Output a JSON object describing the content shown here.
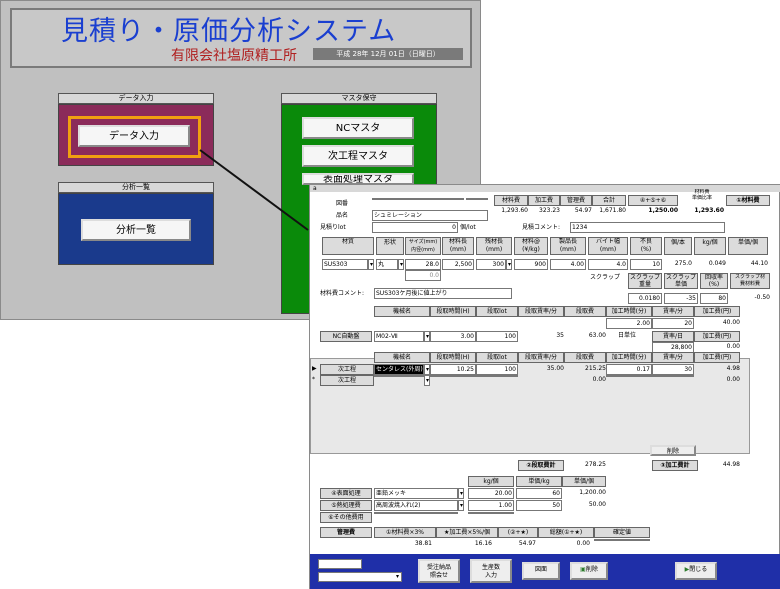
{
  "menu": {
    "title": "見積り・原価分析システム",
    "company": "有限会社塩原精工所",
    "date": "平成 28年 12月 01日（日曜日）",
    "data_entry": {
      "header": "データ入力",
      "button": "データ入力"
    },
    "analysis": {
      "header": "分析一覧",
      "button": "分析一覧"
    },
    "master": {
      "header": "マスタ保守",
      "buttons": [
        "NCマスタ",
        "次工程マスタ",
        "表面処理マスタ"
      ]
    }
  },
  "detail": {
    "form_marker": "a",
    "labels": {
      "zuban": "図番",
      "hinmei": "品名",
      "mitsumori_lot": "見積りlot",
      "lot_unit": "個/lot",
      "comment_label": "見積コメント:",
      "comment_value": "1234",
      "hinmei_value": "シュミレーション",
      "lot_value": "0"
    },
    "summary": {
      "headers": [
        "材料費",
        "加工費",
        "管理費",
        "合計",
        "④+⑤+⑥",
        "材料費\n単価比率",
        "①材料費"
      ],
      "values": [
        "1,293.60",
        "323.23",
        "54.97",
        "1,671.80",
        "1,250.00",
        "1,293.60"
      ]
    },
    "material": {
      "headers": [
        "材質",
        "形状",
        "サイズ(mm)\n内径(mm)",
        "材料長\n(mm)",
        "残材長\n(mm)",
        "材料@\n(¥/kg)",
        "製品長\n(mm)",
        "バイト幅\n(mm)",
        "不良\n(%)",
        "個/本",
        "kg/個",
        "単価/個"
      ],
      "row": [
        "SUS303",
        "丸",
        "28.0",
        "2,500",
        "300",
        "900",
        "4.00",
        "4.0",
        "10",
        "275.0",
        "0.049",
        "44.10"
      ],
      "inner_dia": "0.0",
      "scrap_label": "スクラップ",
      "scrap_headers": [
        "スクラップ\n重量",
        "スクラップ\n単価",
        "回収率\n(%)",
        "スクラップ材\n費材料費"
      ],
      "scrap_values": [
        "0.0180",
        "-35",
        "80",
        "-0.50"
      ],
      "comment_label": "材料費コメント:",
      "comment_value": "SUS303ケ月後に値上がり"
    },
    "nc": {
      "headers": [
        "機械名",
        "段取時間(H)",
        "段取lot",
        "段取賃率/分",
        "段取費",
        "加工時間(分)",
        "賃率/分",
        "加工費(円)"
      ],
      "label": "NC自動盤",
      "row": [
        "M02-Ⅶ",
        "3.00",
        "100",
        "35",
        "63.00"
      ],
      "process_values": [
        "2.00",
        "20",
        "40.00"
      ],
      "day_label": "日単位",
      "day_headers": [
        "賃率/日",
        "加工費(円)"
      ],
      "day_values": [
        "28,800",
        "0.00"
      ]
    },
    "next_process": {
      "headers": [
        "機械名",
        "段取時間(H)",
        "段取lot",
        "段取賃率/分",
        "段取費",
        "加工時間(分)",
        "賃率/分",
        "加工費(円)"
      ],
      "rows": [
        {
          "label": "次工程",
          "values": [
            "センタレス(外周)",
            "10.25",
            "100",
            "35.00",
            "215.25",
            "0.17",
            "30",
            "4.98"
          ]
        },
        {
          "label": "次工程",
          "values": [
            "",
            "",
            "",
            "",
            "0.00",
            "",
            "",
            "0.00"
          ]
        }
      ],
      "delete_button": "削除",
      "setup_total_label": "②段取費計",
      "setup_total": "278.25",
      "process_total_label": "③加工費計",
      "process_total": "44.98"
    },
    "surface": {
      "headers": [
        "kg/個",
        "単価/kg",
        "単価/個"
      ],
      "rows": [
        {
          "label": "④表面処理",
          "name": "亜鉛メッキ",
          "values": [
            "20.00",
            "60",
            "1,200.00"
          ]
        },
        {
          "label": "⑤熱処理費",
          "name": "高周波焼入れ(2)",
          "values": [
            "1.00",
            "50",
            "50.00"
          ]
        },
        {
          "label": "⑥その他費用",
          "name": "",
          "values": [
            "",
            "",
            ""
          ]
        }
      ]
    },
    "management": {
      "label": "管理費",
      "headers": [
        "①材料費×3%",
        "★加工費×5%/個",
        "(②+★)",
        "総額(①+★)",
        "確定値"
      ],
      "values": [
        "38.81",
        "16.16",
        "54.97",
        "0.00",
        ""
      ]
    },
    "bottom": {
      "buttons": [
        "受注納品\n照会せ",
        "生産数\n入力",
        "図面",
        "削除",
        "閉じる"
      ]
    },
    "colors": {
      "title_blue": "#1a3fd0",
      "company_red": "#b02020",
      "data_entry_bg": "#8b2b5a",
      "analysis_bg": "#1a3a8c",
      "master_bg": "#0a8a0a",
      "highlight": "#f0a010",
      "bottom_bar": "#1f2fa8"
    }
  }
}
